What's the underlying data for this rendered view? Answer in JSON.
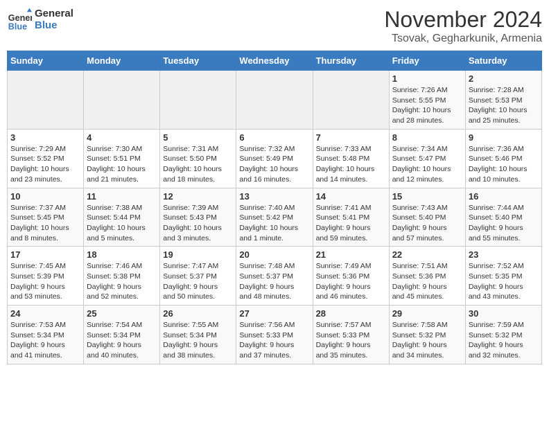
{
  "header": {
    "logo_line1": "General",
    "logo_line2": "Blue",
    "month": "November 2024",
    "location": "Tsovak, Gegharkunik, Armenia"
  },
  "weekdays": [
    "Sunday",
    "Monday",
    "Tuesday",
    "Wednesday",
    "Thursday",
    "Friday",
    "Saturday"
  ],
  "weeks": [
    [
      {
        "day": "",
        "info": ""
      },
      {
        "day": "",
        "info": ""
      },
      {
        "day": "",
        "info": ""
      },
      {
        "day": "",
        "info": ""
      },
      {
        "day": "",
        "info": ""
      },
      {
        "day": "1",
        "info": "Sunrise: 7:26 AM\nSunset: 5:55 PM\nDaylight: 10 hours\nand 28 minutes."
      },
      {
        "day": "2",
        "info": "Sunrise: 7:28 AM\nSunset: 5:53 PM\nDaylight: 10 hours\nand 25 minutes."
      }
    ],
    [
      {
        "day": "3",
        "info": "Sunrise: 7:29 AM\nSunset: 5:52 PM\nDaylight: 10 hours\nand 23 minutes."
      },
      {
        "day": "4",
        "info": "Sunrise: 7:30 AM\nSunset: 5:51 PM\nDaylight: 10 hours\nand 21 minutes."
      },
      {
        "day": "5",
        "info": "Sunrise: 7:31 AM\nSunset: 5:50 PM\nDaylight: 10 hours\nand 18 minutes."
      },
      {
        "day": "6",
        "info": "Sunrise: 7:32 AM\nSunset: 5:49 PM\nDaylight: 10 hours\nand 16 minutes."
      },
      {
        "day": "7",
        "info": "Sunrise: 7:33 AM\nSunset: 5:48 PM\nDaylight: 10 hours\nand 14 minutes."
      },
      {
        "day": "8",
        "info": "Sunrise: 7:34 AM\nSunset: 5:47 PM\nDaylight: 10 hours\nand 12 minutes."
      },
      {
        "day": "9",
        "info": "Sunrise: 7:36 AM\nSunset: 5:46 PM\nDaylight: 10 hours\nand 10 minutes."
      }
    ],
    [
      {
        "day": "10",
        "info": "Sunrise: 7:37 AM\nSunset: 5:45 PM\nDaylight: 10 hours\nand 8 minutes."
      },
      {
        "day": "11",
        "info": "Sunrise: 7:38 AM\nSunset: 5:44 PM\nDaylight: 10 hours\nand 5 minutes."
      },
      {
        "day": "12",
        "info": "Sunrise: 7:39 AM\nSunset: 5:43 PM\nDaylight: 10 hours\nand 3 minutes."
      },
      {
        "day": "13",
        "info": "Sunrise: 7:40 AM\nSunset: 5:42 PM\nDaylight: 10 hours\nand 1 minute."
      },
      {
        "day": "14",
        "info": "Sunrise: 7:41 AM\nSunset: 5:41 PM\nDaylight: 9 hours\nand 59 minutes."
      },
      {
        "day": "15",
        "info": "Sunrise: 7:43 AM\nSunset: 5:40 PM\nDaylight: 9 hours\nand 57 minutes."
      },
      {
        "day": "16",
        "info": "Sunrise: 7:44 AM\nSunset: 5:40 PM\nDaylight: 9 hours\nand 55 minutes."
      }
    ],
    [
      {
        "day": "17",
        "info": "Sunrise: 7:45 AM\nSunset: 5:39 PM\nDaylight: 9 hours\nand 53 minutes."
      },
      {
        "day": "18",
        "info": "Sunrise: 7:46 AM\nSunset: 5:38 PM\nDaylight: 9 hours\nand 52 minutes."
      },
      {
        "day": "19",
        "info": "Sunrise: 7:47 AM\nSunset: 5:37 PM\nDaylight: 9 hours\nand 50 minutes."
      },
      {
        "day": "20",
        "info": "Sunrise: 7:48 AM\nSunset: 5:37 PM\nDaylight: 9 hours\nand 48 minutes."
      },
      {
        "day": "21",
        "info": "Sunrise: 7:49 AM\nSunset: 5:36 PM\nDaylight: 9 hours\nand 46 minutes."
      },
      {
        "day": "22",
        "info": "Sunrise: 7:51 AM\nSunset: 5:36 PM\nDaylight: 9 hours\nand 45 minutes."
      },
      {
        "day": "23",
        "info": "Sunrise: 7:52 AM\nSunset: 5:35 PM\nDaylight: 9 hours\nand 43 minutes."
      }
    ],
    [
      {
        "day": "24",
        "info": "Sunrise: 7:53 AM\nSunset: 5:34 PM\nDaylight: 9 hours\nand 41 minutes."
      },
      {
        "day": "25",
        "info": "Sunrise: 7:54 AM\nSunset: 5:34 PM\nDaylight: 9 hours\nand 40 minutes."
      },
      {
        "day": "26",
        "info": "Sunrise: 7:55 AM\nSunset: 5:34 PM\nDaylight: 9 hours\nand 38 minutes."
      },
      {
        "day": "27",
        "info": "Sunrise: 7:56 AM\nSunset: 5:33 PM\nDaylight: 9 hours\nand 37 minutes."
      },
      {
        "day": "28",
        "info": "Sunrise: 7:57 AM\nSunset: 5:33 PM\nDaylight: 9 hours\nand 35 minutes."
      },
      {
        "day": "29",
        "info": "Sunrise: 7:58 AM\nSunset: 5:32 PM\nDaylight: 9 hours\nand 34 minutes."
      },
      {
        "day": "30",
        "info": "Sunrise: 7:59 AM\nSunset: 5:32 PM\nDaylight: 9 hours\nand 32 minutes."
      }
    ]
  ]
}
